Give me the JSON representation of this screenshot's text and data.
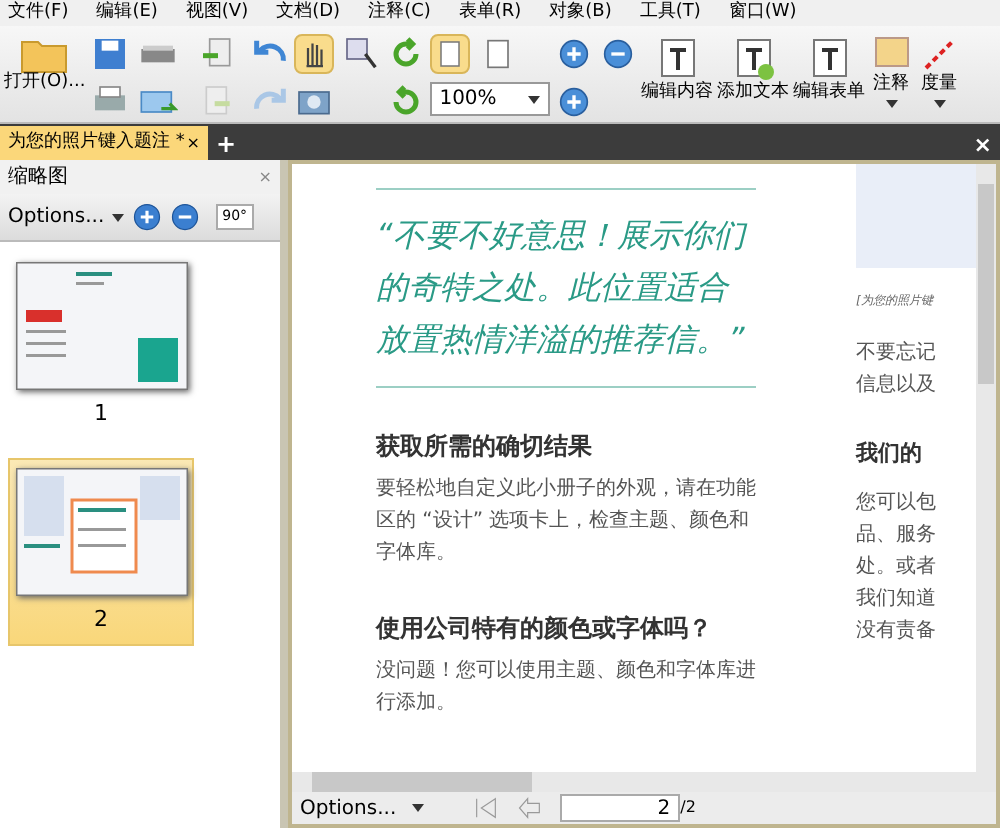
{
  "menu": [
    "文件(F)",
    "编辑(E)",
    "视图(V)",
    "文档(D)",
    "注释(C)",
    "表单(R)",
    "对象(B)",
    "工具(T)",
    "窗口(W)"
  ],
  "toolbar": {
    "open": "打开(O)...",
    "zoom": "100%",
    "buttons": [
      "编辑内容",
      "添加文本",
      "编辑表单"
    ],
    "dropdowns": [
      "注释",
      "度量"
    ]
  },
  "tabs": [
    {
      "label": "为您的照片键入题注 *",
      "selected": true
    }
  ],
  "tab_close": "×",
  "tab_add": "+",
  "window_close": "×",
  "thumbnails": {
    "title": "缩略图",
    "close": "×",
    "options": "Options...",
    "rotate": "90°",
    "pages": [
      {
        "label": "1",
        "selected": false
      },
      {
        "label": "2",
        "selected": true
      }
    ]
  },
  "document": {
    "quote": "“不要不好意思！展示你们的奇特之处。此位置适合放置热情洋溢的推荐信。”",
    "sections": [
      {
        "heading": "获取所需的确切结果",
        "body": "要轻松地自定义此小册子的外观，请在功能区的 “设计” 选项卡上，检查主题、颜色和字体库。"
      },
      {
        "heading": "使用公司特有的颜色或字体吗？",
        "body": "没问题！您可以使用主题、颜色和字体库进行添加。"
      }
    ],
    "side_caption": "[为您的照片键",
    "side_lines": [
      {
        "kind": "text",
        "text": "不要忘记"
      },
      {
        "kind": "text",
        "text": "信息以及"
      },
      {
        "kind": "heading",
        "text": "我们的"
      },
      {
        "kind": "text",
        "text": "您可以包"
      },
      {
        "kind": "text",
        "text": "品、服务"
      },
      {
        "kind": "text",
        "text": "处。或者"
      },
      {
        "kind": "text",
        "text": "我们知道"
      },
      {
        "kind": "text",
        "text": "没有责备"
      }
    ]
  },
  "status": {
    "options": "Options...",
    "page": "2",
    "total": "/2"
  }
}
